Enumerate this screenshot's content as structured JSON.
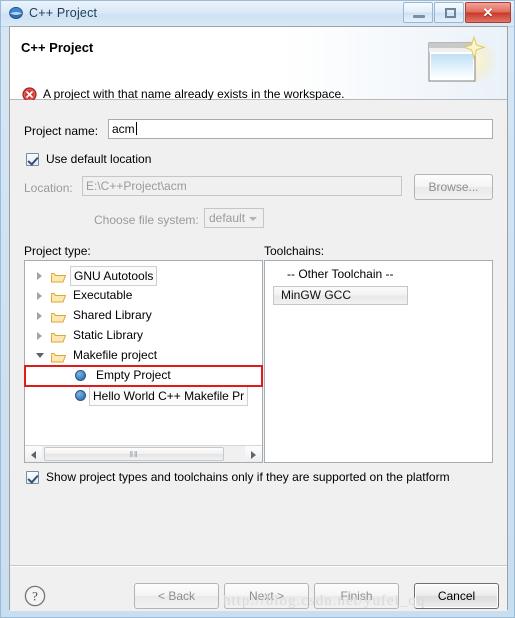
{
  "window": {
    "title": "C++ Project",
    "icon": "eclipse-globe-icon",
    "buttons": {
      "minimize": "–",
      "maximize": "□",
      "close": "✕"
    }
  },
  "header": {
    "title": "C++ Project",
    "message": "A project with that name already exists in the workspace.",
    "message_type": "error",
    "error_color": "#c9302c",
    "art_icon": "new-project-wizard-icon"
  },
  "form": {
    "project_name_label": "Project name:",
    "project_name_value": "acm",
    "project_name_placeholder": "",
    "use_default_location_label": "Use default location",
    "use_default_location_checked": true,
    "location_label": "Location:",
    "location_value": "E:\\C++Project\\acm",
    "location_enabled": false,
    "browse_label": "Browse...",
    "browse_enabled": false,
    "file_system_label": "Choose file system:",
    "file_system_value": "default",
    "file_system_options": [
      "default"
    ],
    "file_system_enabled": false
  },
  "project_type": {
    "label": "Project type:",
    "items": [
      {
        "label": "GNU Autotools",
        "depth": 0,
        "expandable": true,
        "expanded": false,
        "icon": "folder-icon",
        "focused": true
      },
      {
        "label": "Executable",
        "depth": 0,
        "expandable": true,
        "expanded": false,
        "icon": "folder-icon",
        "focused": false
      },
      {
        "label": "Shared Library",
        "depth": 0,
        "expandable": true,
        "expanded": false,
        "icon": "folder-icon",
        "focused": false
      },
      {
        "label": "Static Library",
        "depth": 0,
        "expandable": true,
        "expanded": false,
        "icon": "folder-icon",
        "focused": false
      },
      {
        "label": "Makefile project",
        "depth": 0,
        "expandable": true,
        "expanded": true,
        "icon": "folder-icon",
        "focused": false
      },
      {
        "label": "Empty Project",
        "depth": 1,
        "expandable": false,
        "expanded": false,
        "icon": "project-dot-icon",
        "focused": false
      },
      {
        "label": "Hello World C++ Makefile Pr",
        "depth": 1,
        "expandable": false,
        "expanded": false,
        "icon": "project-dot-icon",
        "focused": true
      }
    ],
    "scrollbar": {
      "grip": "‖‖"
    }
  },
  "toolchains": {
    "label": "Toolchains:",
    "items": [
      {
        "label": "-- Other Toolchain --",
        "selected": false
      },
      {
        "label": "MinGW GCC",
        "selected": true
      }
    ]
  },
  "filter": {
    "label": "Show project types and toolchains only if they are supported on the platform",
    "checked": true
  },
  "footer": {
    "help_icon": "help-question-icon",
    "buttons": [
      {
        "label": "< Back",
        "enabled": false,
        "default": false
      },
      {
        "label": "Next >",
        "enabled": false,
        "default": false
      },
      {
        "label": "Finish",
        "enabled": false,
        "default": false
      },
      {
        "label": "Cancel",
        "enabled": true,
        "default": true
      }
    ]
  },
  "annotation": {
    "target": "Makefile project",
    "color": "#e01b1b"
  },
  "watermark": {
    "text": "http://blog.csdn.net/yufei_qq"
  }
}
